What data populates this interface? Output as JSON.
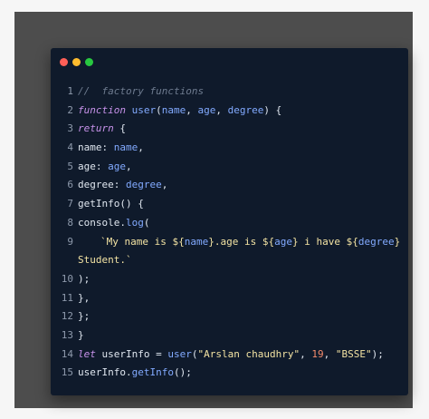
{
  "window": {
    "colors": {
      "red": "#ff5f57",
      "yellow": "#febc2e",
      "green": "#28c840",
      "background": "#0f1a2b"
    }
  },
  "code": {
    "lines": [
      {
        "n": "1",
        "parts": [
          {
            "t": "//  factory functions",
            "c": "k-comment"
          }
        ]
      },
      {
        "n": "2",
        "parts": [
          {
            "t": "function",
            "c": "k-key"
          },
          {
            "t": " ",
            "c": "k-punc"
          },
          {
            "t": "user",
            "c": "k-fn"
          },
          {
            "t": "(",
            "c": "k-punc"
          },
          {
            "t": "name",
            "c": "k-param"
          },
          {
            "t": ", ",
            "c": "k-punc"
          },
          {
            "t": "age",
            "c": "k-param"
          },
          {
            "t": ", ",
            "c": "k-punc"
          },
          {
            "t": "degree",
            "c": "k-param"
          },
          {
            "t": ") {",
            "c": "k-punc"
          }
        ]
      },
      {
        "n": "3",
        "parts": [
          {
            "t": "return",
            "c": "k-key"
          },
          {
            "t": " {",
            "c": "k-punc"
          }
        ]
      },
      {
        "n": "4",
        "parts": [
          {
            "t": "name",
            "c": "k-var"
          },
          {
            "t": ": ",
            "c": "k-punc"
          },
          {
            "t": "name",
            "c": "k-param"
          },
          {
            "t": ",",
            "c": "k-punc"
          }
        ]
      },
      {
        "n": "5",
        "parts": [
          {
            "t": "age",
            "c": "k-var"
          },
          {
            "t": ": ",
            "c": "k-punc"
          },
          {
            "t": "age",
            "c": "k-param"
          },
          {
            "t": ",",
            "c": "k-punc"
          }
        ]
      },
      {
        "n": "6",
        "parts": [
          {
            "t": "degree",
            "c": "k-var"
          },
          {
            "t": ": ",
            "c": "k-punc"
          },
          {
            "t": "degree",
            "c": "k-param"
          },
          {
            "t": ",",
            "c": "k-punc"
          }
        ]
      },
      {
        "n": "7",
        "parts": [
          {
            "t": "getInfo",
            "c": "k-var"
          },
          {
            "t": "() {",
            "c": "k-punc"
          }
        ]
      },
      {
        "n": "8",
        "parts": [
          {
            "t": "console",
            "c": "k-var"
          },
          {
            "t": ".",
            "c": "k-punc"
          },
          {
            "t": "log",
            "c": "k-fn"
          },
          {
            "t": "(",
            "c": "k-punc"
          }
        ]
      },
      {
        "n": "9",
        "indent": true,
        "parts": [
          {
            "t": "`My name is ",
            "c": "k-str"
          },
          {
            "t": "${",
            "c": "k-str"
          },
          {
            "t": "name",
            "c": "k-param"
          },
          {
            "t": "}",
            "c": "k-str"
          },
          {
            "t": ".age is ",
            "c": "k-str"
          },
          {
            "t": "${",
            "c": "k-str"
          },
          {
            "t": "age",
            "c": "k-param"
          },
          {
            "t": "}",
            "c": "k-str"
          },
          {
            "t": " i have ",
            "c": "k-str"
          },
          {
            "t": "${",
            "c": "k-str"
          },
          {
            "t": "degree",
            "c": "k-param"
          },
          {
            "t": "}",
            "c": "k-str"
          }
        ]
      },
      {
        "n": "",
        "parts": [
          {
            "t": "Student.`",
            "c": "k-str"
          }
        ]
      },
      {
        "n": "10",
        "parts": [
          {
            "t": ");",
            "c": "k-punc"
          }
        ]
      },
      {
        "n": "11",
        "parts": [
          {
            "t": "},",
            "c": "k-punc"
          }
        ]
      },
      {
        "n": "12",
        "parts": [
          {
            "t": "};",
            "c": "k-punc"
          }
        ]
      },
      {
        "n": "13",
        "parts": [
          {
            "t": "}",
            "c": "k-punc"
          }
        ]
      },
      {
        "n": "14",
        "parts": [
          {
            "t": "let",
            "c": "k-key"
          },
          {
            "t": " userInfo = ",
            "c": "k-var"
          },
          {
            "t": "user",
            "c": "k-fn"
          },
          {
            "t": "(",
            "c": "k-punc"
          },
          {
            "t": "\"Arslan chaudhry\"",
            "c": "k-str"
          },
          {
            "t": ", ",
            "c": "k-punc"
          },
          {
            "t": "19",
            "c": "k-num"
          },
          {
            "t": ", ",
            "c": "k-punc"
          },
          {
            "t": "\"BSSE\"",
            "c": "k-str"
          },
          {
            "t": ");",
            "c": "k-punc"
          }
        ]
      },
      {
        "n": "15",
        "parts": [
          {
            "t": "userInfo",
            "c": "k-var"
          },
          {
            "t": ".",
            "c": "k-punc"
          },
          {
            "t": "getInfo",
            "c": "k-fn"
          },
          {
            "t": "();",
            "c": "k-punc"
          }
        ]
      }
    ]
  }
}
